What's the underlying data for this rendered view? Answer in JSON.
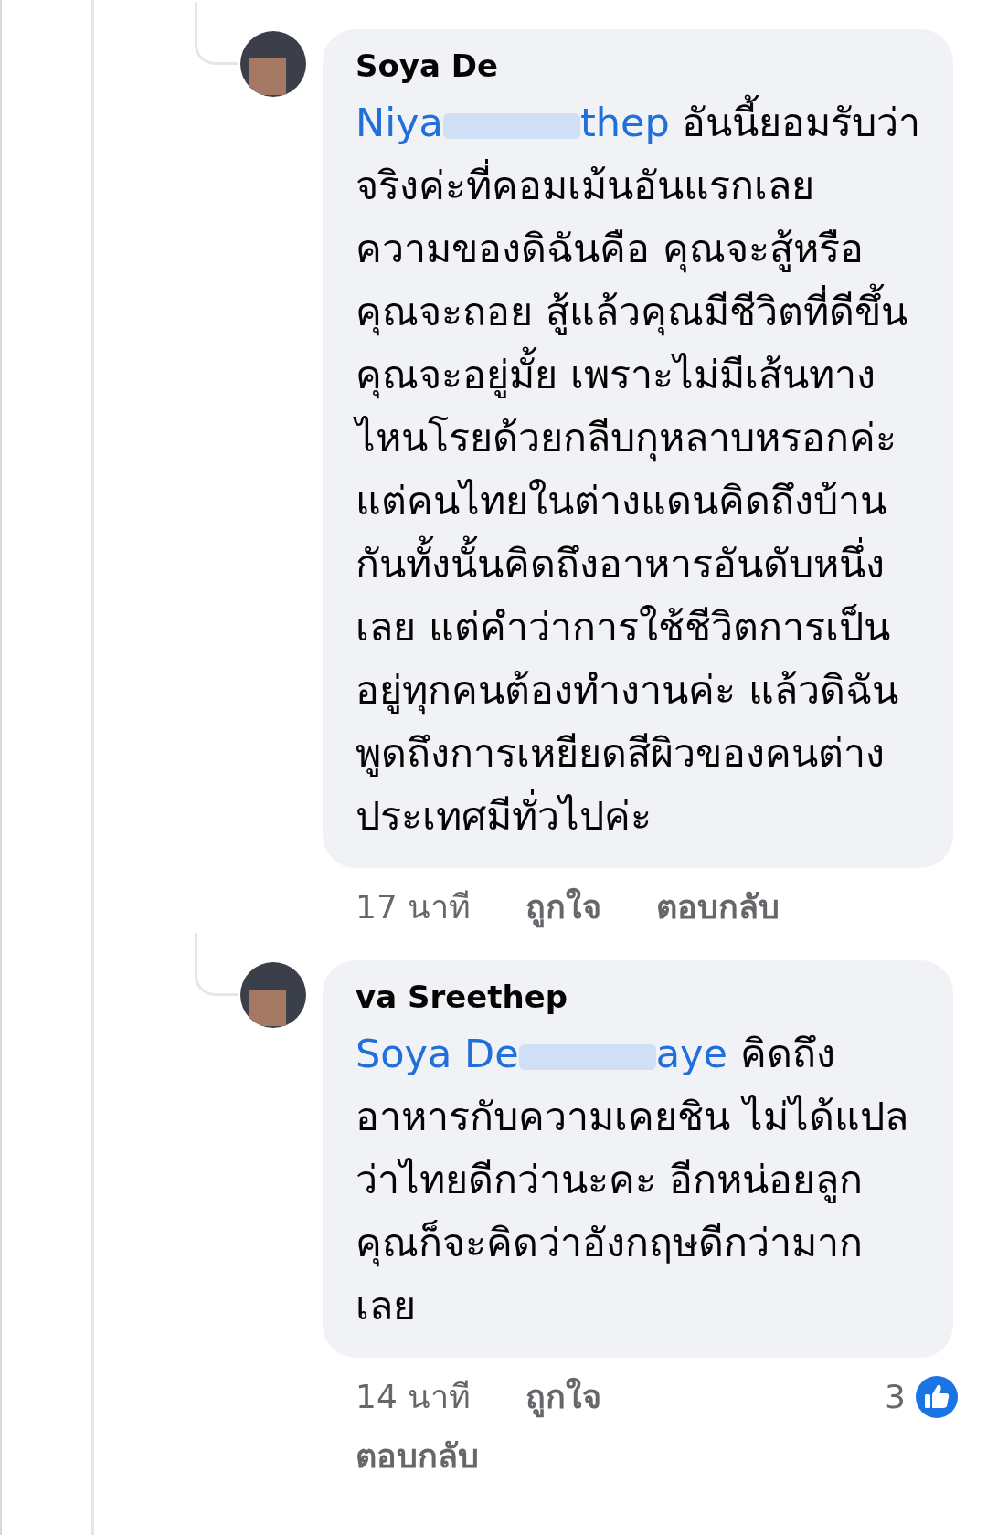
{
  "comments": [
    {
      "author": {
        "visible": "Soya De"
      },
      "mention": {
        "start": "Niya",
        "end": "thep"
      },
      "text": "อันนี้ยอมรับว่าจริงค่ะที่คอมเม้นอันแรกเลย ความของดิฉันคือ คุณจะสู้หรือคุณจะถอย สู้แล้วคุณมีชีวิตที่ดีขึ้นคุณจะอยู่มั้ย เพราะไม่มีเส้นทางไหนโรยด้วยกลีบกุหลาบหรอกค่ะ แต่คนไทยในต่างแดนคิดถึงบ้านกันทั้งนั้นคิดถึงอาหารอันดับหนึ่งเลย แต่คำว่าการใช้ชีวิตการเป็นอยู่ทุกคนต้องทำงานค่ะ แล้วดิฉันพูดถึงการเหยียดสีผิวของคนต่างประเทศมีทั่วไปค่ะ",
      "time": "17 นาที",
      "like": "ถูกใจ",
      "reply": "ตอบกลับ"
    },
    {
      "author": {
        "visible": "va Sreethep"
      },
      "mention": {
        "start": "Soya De",
        "end": "aye"
      },
      "text": "คิดถึงอาหารกับความเคยชิน ไม่ได้แปลว่าไทยดีกว่านะคะ อีกหน่อยลูกคุณก็จะคิดว่าอังกฤษดีกว่ามากเลย",
      "time": "14 นาที",
      "like": "ถูกใจ",
      "reply": "ตอบกลับ",
      "reactions": "3"
    }
  ]
}
